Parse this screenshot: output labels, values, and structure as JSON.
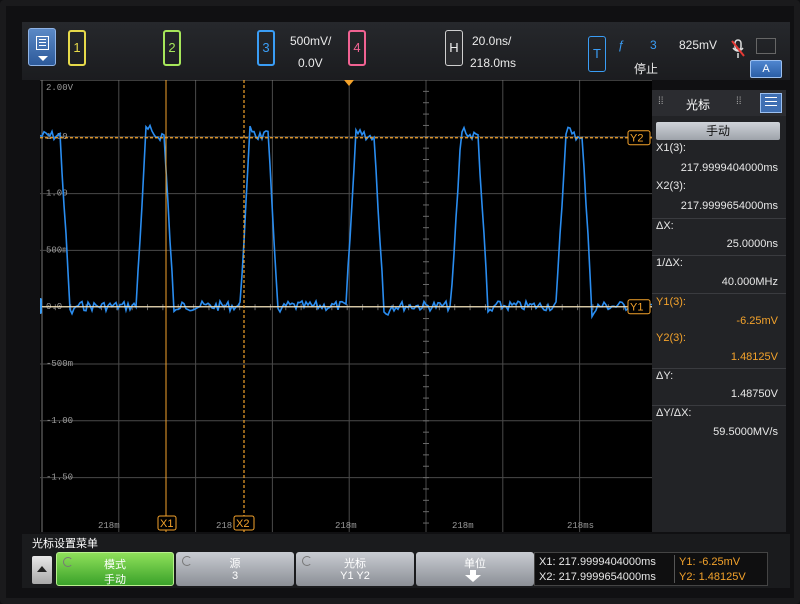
{
  "toolbar": {
    "channels": [
      {
        "label": "1",
        "color": "#e6d94a"
      },
      {
        "label": "2",
        "color": "#a6e65a"
      },
      {
        "label": "3",
        "color": "#3a9df5"
      },
      {
        "label": "4",
        "color": "#f06292"
      }
    ],
    "ch3_scale": "500mV/",
    "ch3_offset": "0.0V",
    "horiz_label": "H",
    "time_scale": "20.0ns/",
    "time_delay": "218.0ms",
    "trigger_label": "T",
    "trigger_edge": "ƒ",
    "trigger_channel": "3",
    "trigger_level": "825mV",
    "run_state": "停止",
    "auto_label": "A"
  },
  "graticule": {
    "y_labels": [
      "2.00V",
      "1.50",
      "1.00",
      "500m",
      "0.0",
      "-500m",
      "-1.00",
      "-1.50"
    ],
    "x_labels": [
      "218m",
      "218",
      "218m",
      "218m",
      "218ms"
    ],
    "ch3_marker": "3",
    "cursor_labels": {
      "x1": "X1",
      "x2": "X2",
      "y1": "Y1",
      "y2": "Y2"
    },
    "trace_color": "#2a8df0",
    "cursor_color": "#f3a22b"
  },
  "cursor_panel": {
    "title": "光标",
    "mode": "手动",
    "x1_label": "X1(3):",
    "x1_value": "217.9999404000ms",
    "x2_label": "X2(3):",
    "x2_value": "217.9999654000ms",
    "dx_label": "ΔX:",
    "dx_value": "25.0000ns",
    "inv_dx_label": "1/ΔX:",
    "inv_dx_value": "40.000MHz",
    "y1_label": "Y1(3):",
    "y1_value": "-6.25mV",
    "y2_label": "Y2(3):",
    "y2_value": "1.48125V",
    "dy_label": "ΔY:",
    "dy_value": "1.48750V",
    "dydx_label": "ΔY/ΔX:",
    "dydx_value": "59.5000MV/s"
  },
  "softkeys": {
    "menu_title": "光标设置菜单",
    "mode": {
      "label": "模式",
      "value": "手动"
    },
    "source": {
      "label": "源",
      "value": "3"
    },
    "cursors": {
      "label": "光标",
      "value": "Y1 Y2"
    },
    "units": {
      "label": "单位"
    }
  },
  "readout": {
    "x1": "X1: 217.9999404000ms",
    "x2": "X2: 217.9999654000ms",
    "y1": "Y1: -6.25mV",
    "y2": "Y2: 1.48125V"
  }
}
